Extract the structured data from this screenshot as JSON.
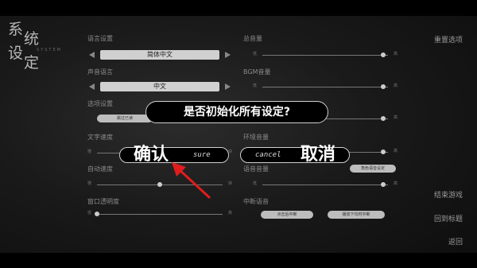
{
  "logo": {
    "chars": [
      "系",
      "统",
      "设",
      "定"
    ],
    "sub": "SYSTEM"
  },
  "left": {
    "lang_label": "语言设置",
    "lang_value": "简体中文",
    "voice_label": "声音语言",
    "voice_value": "中文",
    "options_label": "选项设置",
    "skip_read_label": "跳过已读",
    "text_speed_label": "文字速度",
    "auto_speed_label": "自动速度",
    "window_alpha_label": "窗口透明度",
    "lo": "低",
    "hi": "高",
    "slow": "慢",
    "fast": "快"
  },
  "right": {
    "master_label": "总音量",
    "bgm_label": "BGM音量",
    "env_label": "环境音量",
    "voice_vol_label": "语音音量",
    "char_voice_btn": "角色语音设定",
    "interrupt_label": "中断语音",
    "interrupt_click": "点击后中断",
    "interrupt_next": "播放下句时中断"
  },
  "menu": {
    "reset": "重置选项",
    "end_game": "结束游戏",
    "back_title": "回到标题",
    "back": "返回"
  },
  "dialog": {
    "question": "是否初始化所有设定?",
    "sure_label": "sure",
    "cancel_label": "cancel",
    "confirm_brush": "确认",
    "cancel_brush": "取消"
  },
  "slider_levels": {
    "master": 0.96,
    "bgm": 0.96,
    "env": 0.96,
    "voice": 0.96,
    "text_speed": 0.5,
    "auto_speed": 0.5,
    "window_alpha": 0.0
  },
  "colors": {
    "background": "#1a1a1a",
    "dialog_border": "#cfcfcf",
    "arrow": "#e21c1c"
  }
}
